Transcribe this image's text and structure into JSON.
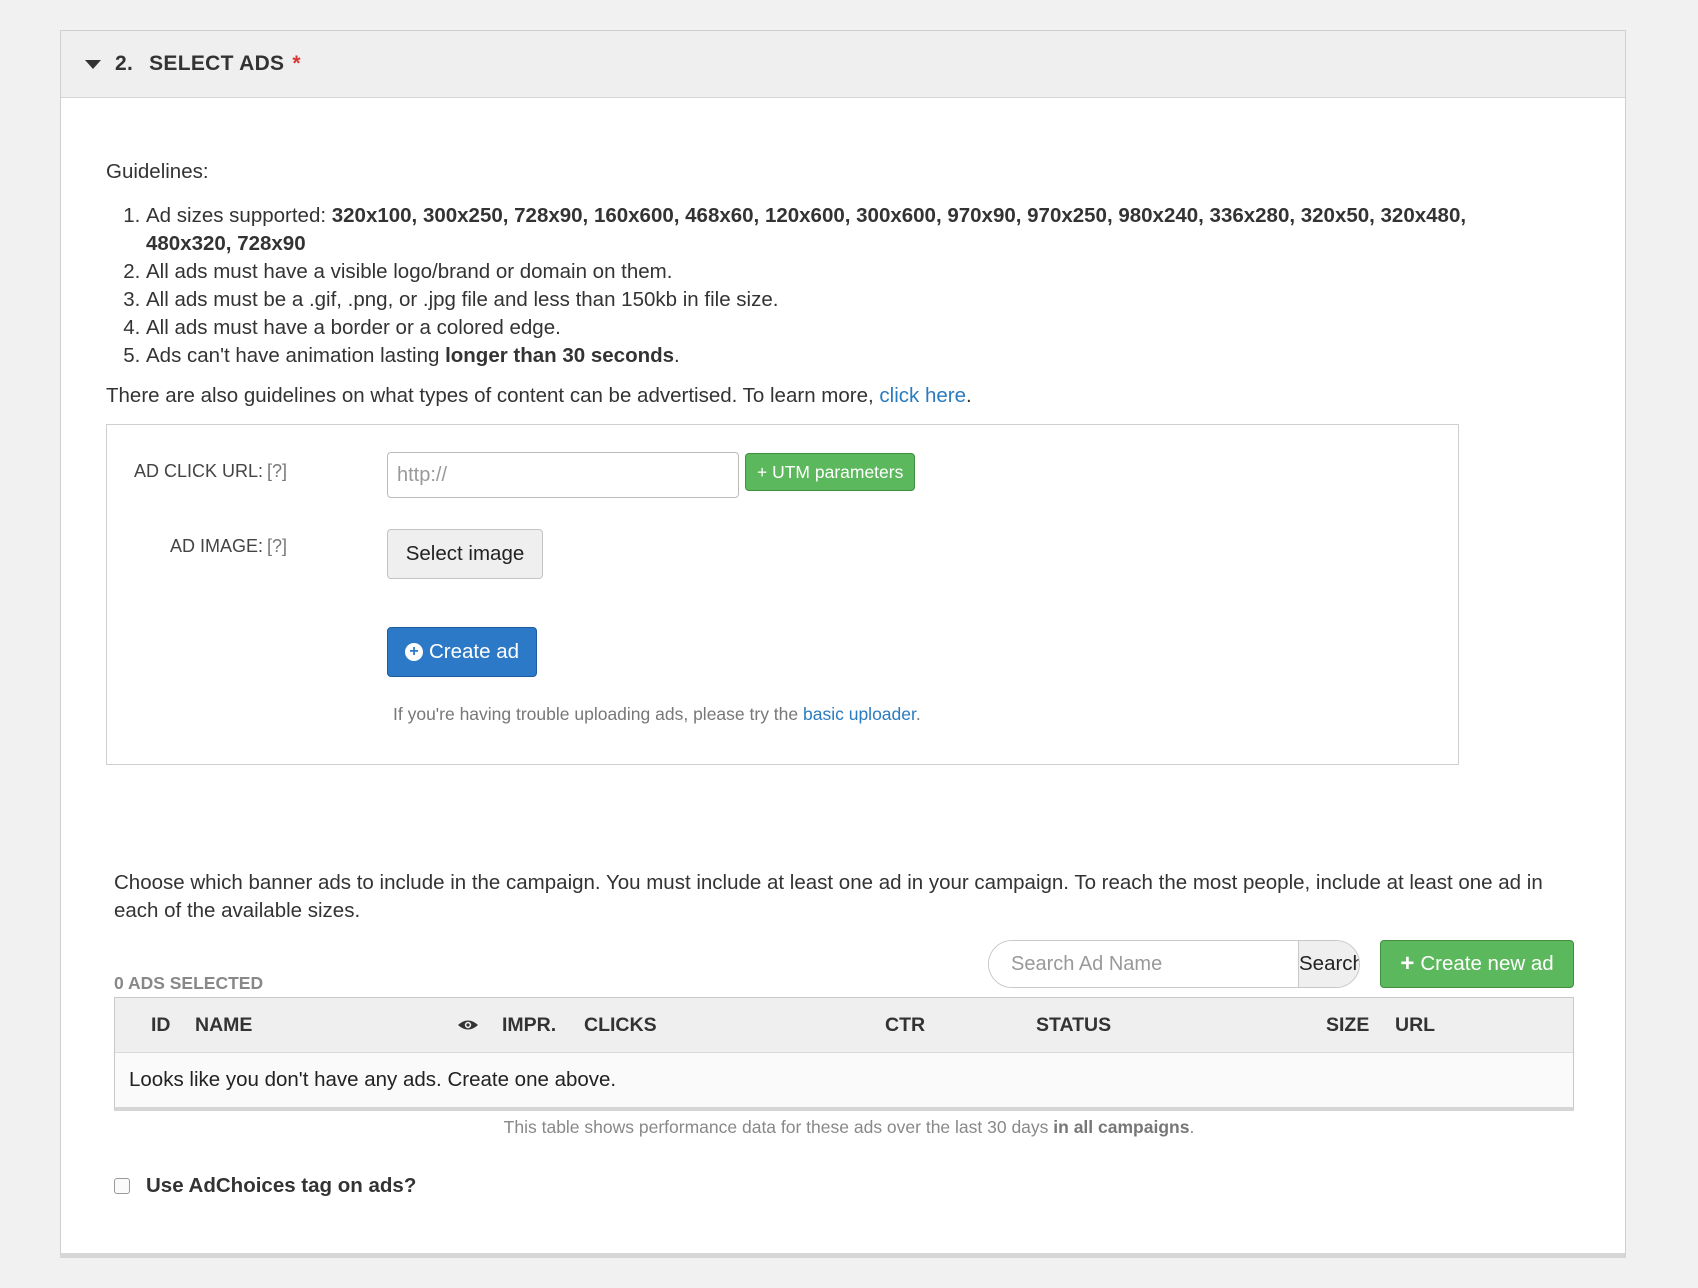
{
  "section": {
    "step_number": "2.",
    "title": "SELECT ADS",
    "required_marker": "*"
  },
  "guidelines": {
    "heading": "Guidelines:",
    "items": [
      {
        "text": "Ad sizes supported: ",
        "bold": "320x100, 300x250, 728x90, 160x600, 468x60, 120x600, 300x600, 970x90, 970x250, 980x240, 336x280, 320x50, 320x480, 480x320, 728x90",
        "after": ""
      },
      {
        "text": "All ads must have a visible logo/brand or domain on them.",
        "bold": "",
        "after": ""
      },
      {
        "text": "All ads must be a .gif, .png, or .jpg file and less than 150kb in file size.",
        "bold": "",
        "after": ""
      },
      {
        "text": "All ads must have a border or a colored edge.",
        "bold": "",
        "after": ""
      },
      {
        "text": "Ads can't have animation lasting ",
        "bold": "longer than 30 seconds",
        "after": "."
      }
    ],
    "content_note": "There are also guidelines on what types of content can be advertised. To learn more, ",
    "content_link": "click here",
    "content_note_end": "."
  },
  "form": {
    "click_url_label": "AD CLICK URL:",
    "help_marker": "[?]",
    "click_url_placeholder": "http://",
    "click_url_value": "",
    "utm_button": "+ UTM parameters",
    "image_label": "AD IMAGE:",
    "select_image_button": "Select image",
    "create_ad_button": "Create ad",
    "trouble_text": "If you're having trouble uploading ads, please try the ",
    "trouble_link": "basic uploader",
    "trouble_end": "."
  },
  "choose_text": "Choose which banner ads to include in the campaign. You must include at least one ad in your campaign. To reach the most people, include at least one ad in each of the available sizes.",
  "search": {
    "placeholder": "Search Ad Name",
    "button": "Search"
  },
  "create_new_button": "Create new ad",
  "ads_selected": "0 ADS SELECTED",
  "table": {
    "columns": {
      "id": "ID",
      "name": "NAME",
      "impr": "IMPR.",
      "clicks": "CLICKS",
      "ctr": "CTR",
      "status": "STATUS",
      "size": "SIZE",
      "url": "URL"
    },
    "empty_message": "Looks like you don't have any ads. Create one above."
  },
  "performance_note": "This table shows performance data for these ads over the last 30 days ",
  "performance_note_bold": "in all campaigns",
  "performance_note_end": ".",
  "adchoices_label": "Use AdChoices tag on ads?",
  "colors": {
    "primary": "#2c79c7",
    "success": "#5cb85c",
    "link": "#2a7bbf",
    "required": "#dd3333"
  }
}
